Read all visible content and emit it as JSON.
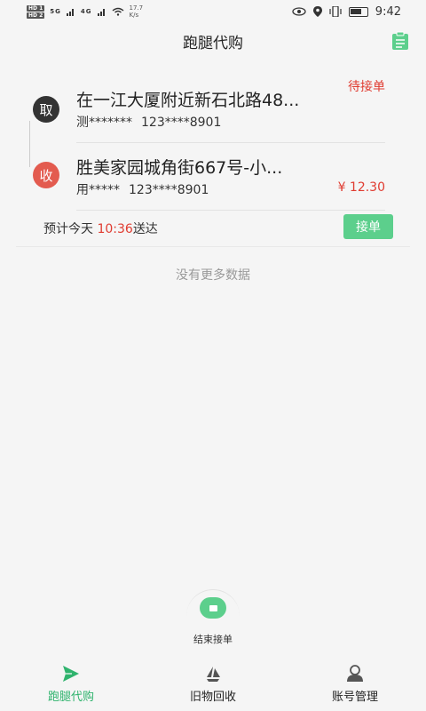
{
  "status_bar": {
    "hd1": "HD 1",
    "hd2": "HD 2",
    "signal1": "5G",
    "signal2": "4G",
    "speed_value": "17.7",
    "speed_unit": "K/s",
    "time": "9:42"
  },
  "header": {
    "title": "跑腿代购",
    "icon": "clipboard-icon"
  },
  "order": {
    "status": "待接单",
    "pickup_badge": "取",
    "pickup_address": "在一江大厦附近新石北路48...",
    "pickup_name": "测*******",
    "pickup_phone": "123****8901",
    "deliver_badge": "收",
    "deliver_address": "胜美家园城角街667号-小...",
    "deliver_name": "用*****",
    "deliver_phone": "123****8901",
    "price": "¥ 12.30",
    "eta_prefix": "预计今天",
    "eta_time": "10:36",
    "eta_suffix": "送达",
    "accept_label": "接单"
  },
  "list": {
    "no_more_text": "没有更多数据"
  },
  "end_button": {
    "label": "结束接单"
  },
  "tabs": [
    {
      "label": "跑腿代购",
      "icon": "paper-plane-icon",
      "active": true
    },
    {
      "label": "旧物回收",
      "icon": "recycle-icon",
      "active": false
    },
    {
      "label": "账号管理",
      "icon": "user-icon",
      "active": false
    }
  ],
  "colors": {
    "accent_green": "#5ccf8c",
    "active_tab": "#2fb36d",
    "alert_red": "#e03c31"
  }
}
